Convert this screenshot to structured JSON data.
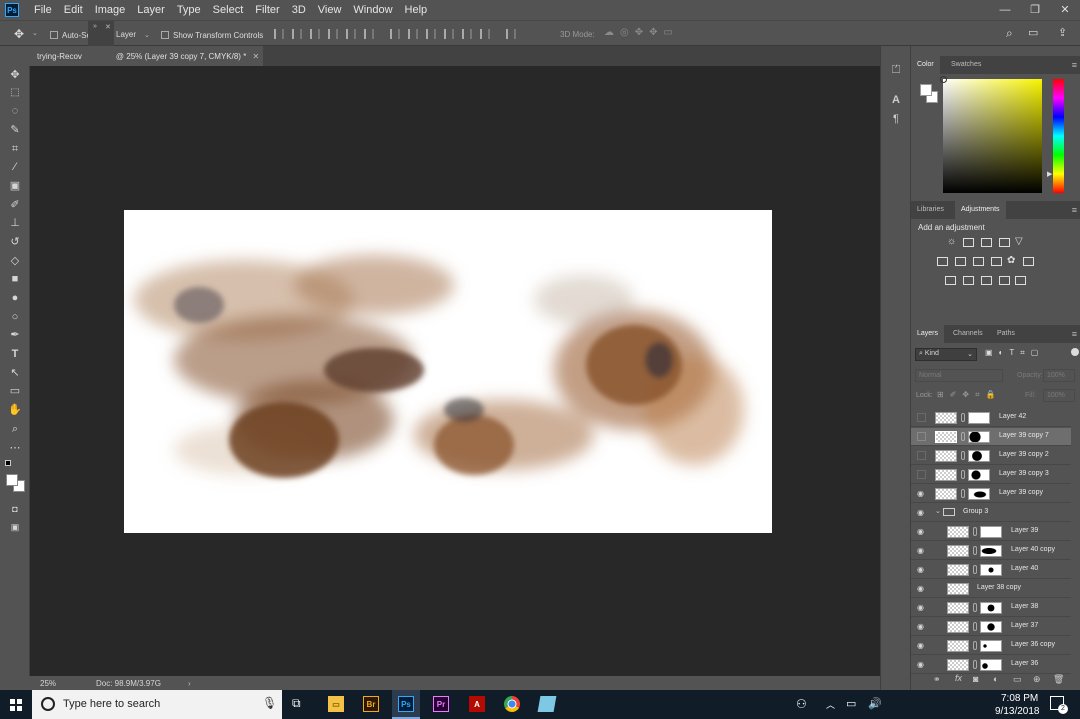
{
  "app": {
    "logo": "Ps"
  },
  "menu": [
    "File",
    "Edit",
    "Image",
    "Layer",
    "Type",
    "Select",
    "Filter",
    "3D",
    "View",
    "Window",
    "Help"
  ],
  "window_controls": {
    "minimize": "—",
    "restore": "❐",
    "close": "✕"
  },
  "options_bar": {
    "auto_select_label": "Auto-Sel",
    "auto_select_target": "Layer",
    "show_transform_label": "Show Transform Controls",
    "mode_3d_label": "3D Mode:"
  },
  "document": {
    "tab_title": "trying-Recov",
    "tab_title_suffix": "@ 25% (Layer 39 copy 7, CMYK/8) *",
    "zoom": "25%",
    "doc_size": "Doc: 98.9M/3.97G"
  },
  "color_panel": {
    "tabs": [
      "Color",
      "Swatches"
    ],
    "active_tab": "Color",
    "hue_color": "#f8f400"
  },
  "adjustments_panel": {
    "tabs": [
      "Libraries",
      "Adjustments"
    ],
    "active_tab": "Adjustments",
    "heading": "Add an adjustment"
  },
  "layers_panel": {
    "tabs": [
      "Layers",
      "Channels",
      "Paths"
    ],
    "active_tab": "Layers",
    "filter_kind": "Kind",
    "blend_mode": "Normal",
    "opacity_label": "Opacity:",
    "opacity_value": "100%",
    "lock_label": "Lock:",
    "fill_label": "Fill:",
    "fill_value": "100%",
    "layers": [
      {
        "name": "Layer 42",
        "visible": false,
        "indent": false,
        "selected": false
      },
      {
        "name": "Layer 39 copy 7",
        "visible": false,
        "indent": false,
        "selected": true
      },
      {
        "name": "Layer 39 copy 2",
        "visible": false,
        "indent": false,
        "selected": false
      },
      {
        "name": "Layer 39 copy 3",
        "visible": false,
        "indent": false,
        "selected": false
      },
      {
        "name": "Layer 39 copy",
        "visible": true,
        "indent": false,
        "selected": false
      },
      {
        "name": "Group 3",
        "visible": true,
        "indent": false,
        "selected": false,
        "group": true
      },
      {
        "name": "Layer 39",
        "visible": true,
        "indent": true,
        "selected": false
      },
      {
        "name": "Layer 40 copy",
        "visible": true,
        "indent": true,
        "selected": false
      },
      {
        "name": "Layer 40",
        "visible": true,
        "indent": true,
        "selected": false
      },
      {
        "name": "Layer 38 copy",
        "visible": true,
        "indent": true,
        "selected": false,
        "no_mask": true
      },
      {
        "name": "Layer 38",
        "visible": true,
        "indent": true,
        "selected": false
      },
      {
        "name": "Layer 37",
        "visible": true,
        "indent": true,
        "selected": false
      },
      {
        "name": "Layer 36 copy",
        "visible": true,
        "indent": true,
        "selected": false
      },
      {
        "name": "Layer 36",
        "visible": true,
        "indent": true,
        "selected": false
      }
    ],
    "footer_fx": "fx"
  },
  "taskbar": {
    "search_placeholder": "Type here to search",
    "time": "7:08 PM",
    "date": "9/13/2018",
    "notification_count": "2",
    "apps": [
      {
        "label": "Br",
        "color": "#2b1a00",
        "text_color": "#f6a623"
      },
      {
        "label": "Ps",
        "color": "#001e36",
        "text_color": "#31a8ff"
      },
      {
        "label": "Pr",
        "color": "#2a0034",
        "text_color": "#e77cff"
      }
    ]
  }
}
